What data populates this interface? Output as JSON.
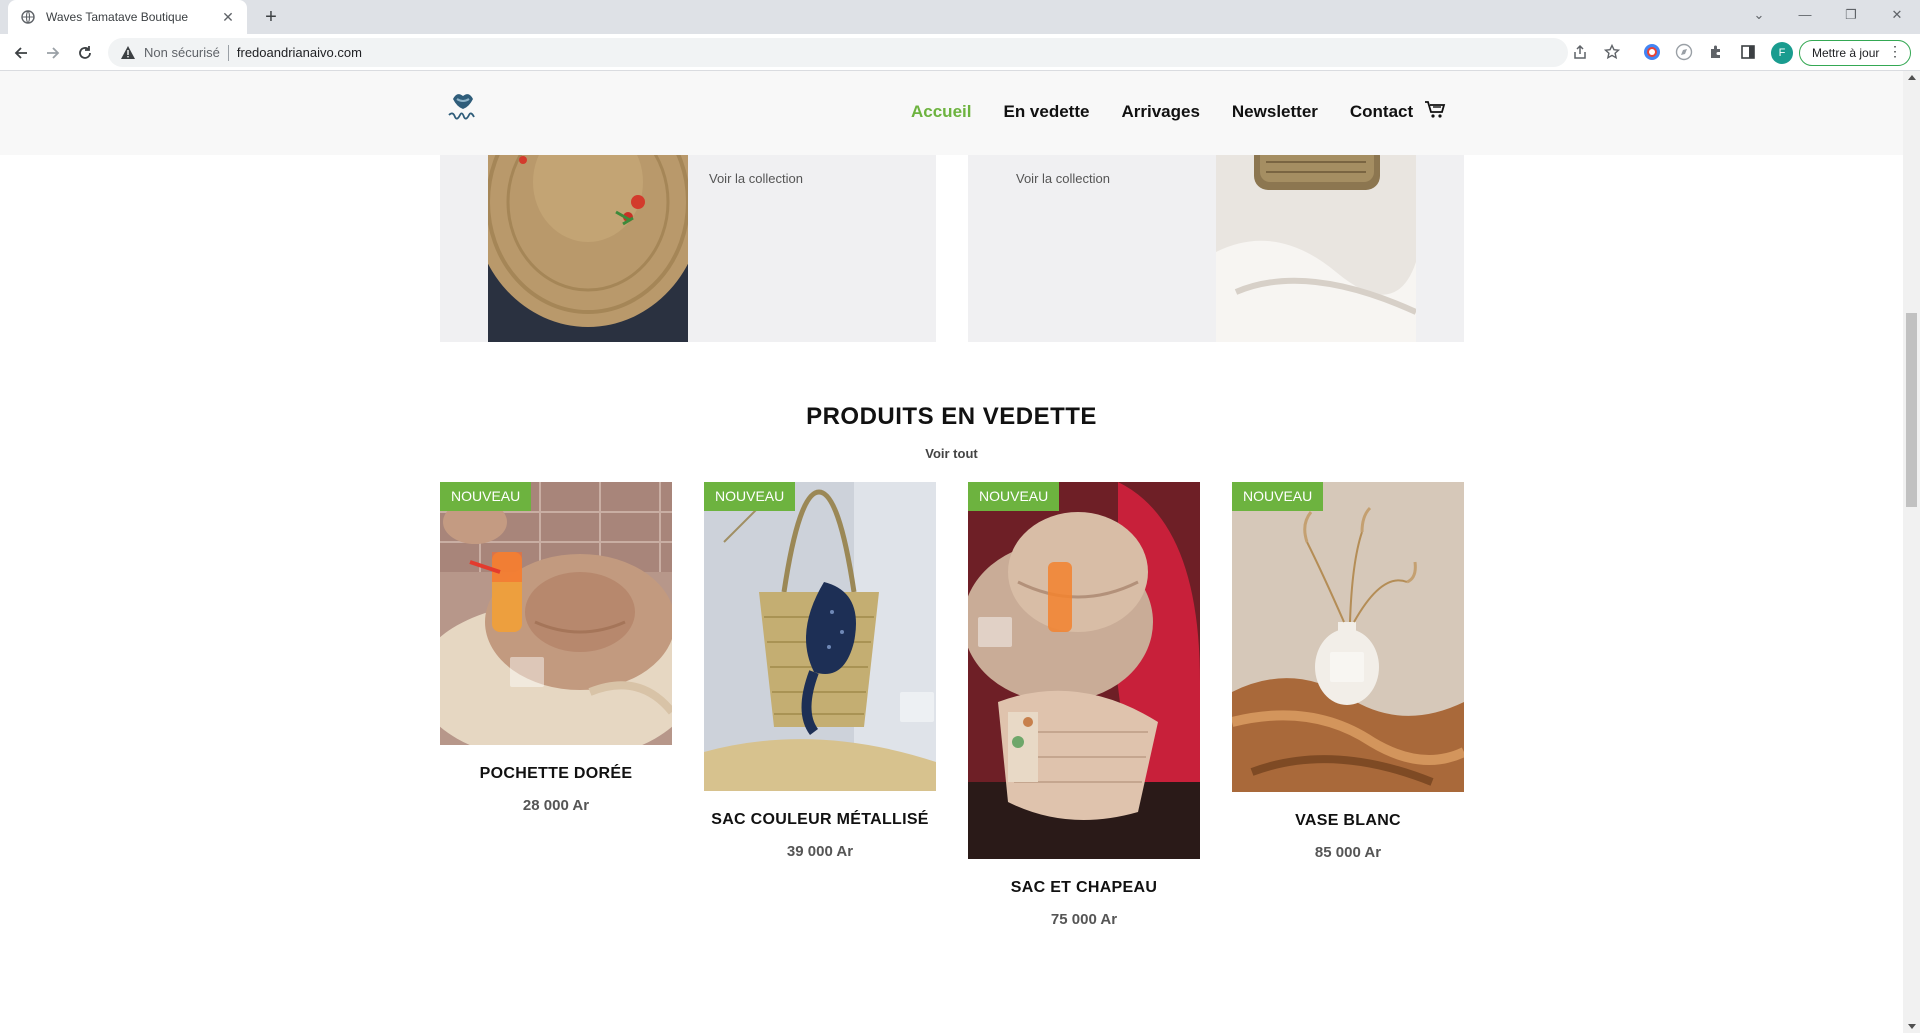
{
  "browser": {
    "tab_title": "Waves Tamatave Boutique",
    "new_tab": "+",
    "insecure_label": "Non sécurisé",
    "url": "fredoandrianaivo.com",
    "profile_initial": "F",
    "update_label": "Mettre à jour"
  },
  "header": {
    "nav": [
      {
        "label": "Accueil",
        "active": true
      },
      {
        "label": "En vedette"
      },
      {
        "label": "Arrivages"
      },
      {
        "label": "Newsletter"
      },
      {
        "label": "Contact"
      }
    ]
  },
  "collections": [
    {
      "link": "Voir la collection"
    },
    {
      "link": "Voir la collection"
    }
  ],
  "featured": {
    "title": "PRODUITS EN VEDETTE",
    "see_all": "Voir tout",
    "products": [
      {
        "badge": "NOUVEAU",
        "name": "POCHETTE DORÉE",
        "price": "28 000 Ar"
      },
      {
        "badge": "NOUVEAU",
        "name": "SAC COULEUR MÉTALLISÉ",
        "price": "39 000 Ar"
      },
      {
        "badge": "NOUVEAU",
        "name": "SAC ET CHAPEAU",
        "price": "75 000 Ar"
      },
      {
        "badge": "NOUVEAU",
        "name": "VASE BLANC",
        "price": "85 000 Ar"
      }
    ]
  },
  "colors": {
    "accent": "#6db33f",
    "header_bg": "#f8f8f8",
    "card_bg": "#f0f0f2"
  }
}
